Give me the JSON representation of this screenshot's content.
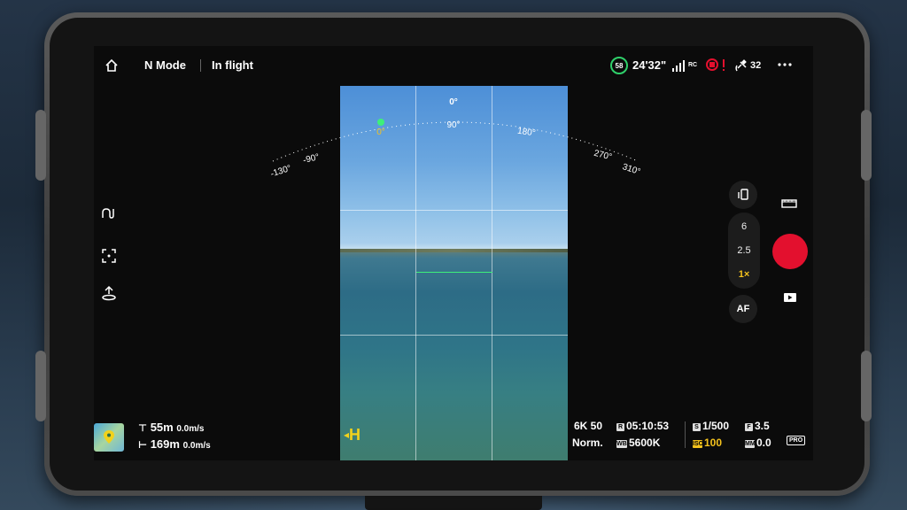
{
  "topbar": {
    "mode": "N Mode",
    "status": "In flight",
    "battery_percent": "58",
    "flight_time": "24'32\"",
    "rc_label": "RC",
    "satellites": "32"
  },
  "gimbal_scale": {
    "top_label": "0°",
    "ticks": [
      "-130°",
      "-90°",
      "0°",
      "90°",
      "180°",
      "270°",
      "310°"
    ],
    "current_heading": "0°"
  },
  "home_point_label": "H",
  "zoom": {
    "options": [
      "6",
      "2.5",
      "1×"
    ],
    "selected": "1×",
    "af_label": "AF"
  },
  "telemetry": {
    "height_value": "55m",
    "vertical_speed": "0.0m/s",
    "distance_value": "169m",
    "horizontal_speed": "0.0m/s"
  },
  "camera_info": {
    "resolution": "6K 50",
    "color_mode": "Norm.",
    "record_remaining": "05:10:53",
    "white_balance": "5600K",
    "shutter": "1/500",
    "iso": "100",
    "aperture": "3.5",
    "ev": "0.0",
    "pro_label": "PRO"
  },
  "icon_badges": {
    "record_badge": "R",
    "wb_badge": "WB",
    "shutter_badge": "S",
    "iso_badge": "ISO",
    "aperture_badge": "F",
    "ev_badge": "MM"
  },
  "colors": {
    "record": "#e3102e",
    "iso": "#f4c21d",
    "battery": "#2fd06a",
    "home_point": "#f2d21c"
  }
}
